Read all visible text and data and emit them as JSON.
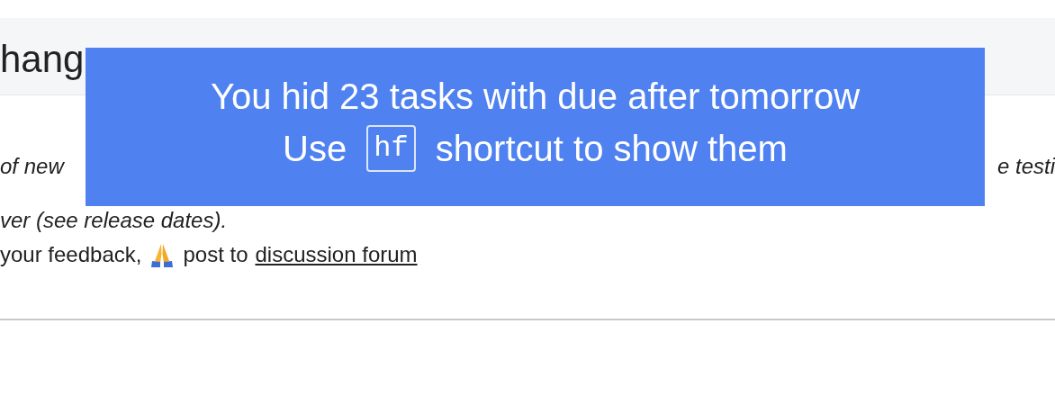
{
  "header": {
    "title": "hang"
  },
  "intro": [
    {
      "start": "of new",
      "end": "e testi"
    },
    {
      "text": "ver (see release dates)."
    }
  ],
  "feedback": {
    "before": "your feedback,",
    "after": "post to",
    "link": "discussion forum"
  },
  "toast": {
    "line1": "You hid 23 tasks with due after tomorrow",
    "before": "Use",
    "key": "hf",
    "after": "shortcut to show them"
  }
}
